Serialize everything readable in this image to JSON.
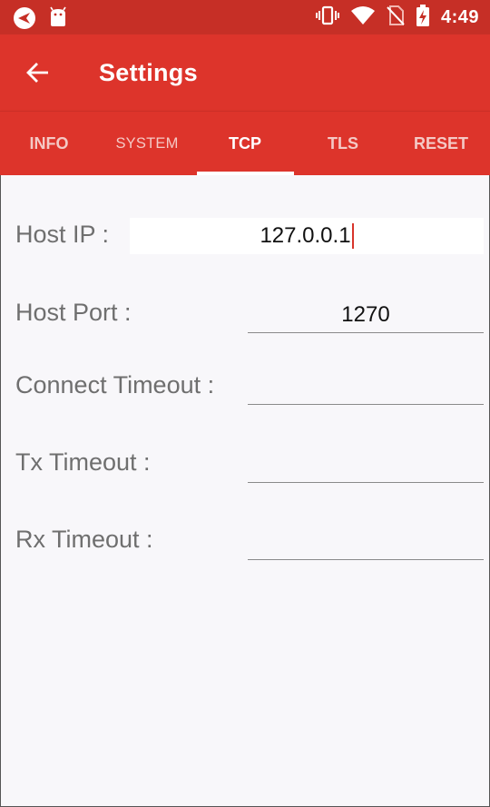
{
  "status_bar": {
    "time": "4:49",
    "icons": [
      "app-logo-icon",
      "android-icon",
      "vibrate-icon",
      "wifi-icon",
      "no-sim-icon",
      "battery-charging-icon"
    ]
  },
  "app_bar": {
    "title": "Settings",
    "back_icon": "arrow-back-icon"
  },
  "tabs": [
    {
      "label": "INFO",
      "active": false
    },
    {
      "label": "SYSTEM",
      "active": false
    },
    {
      "label": "TCP",
      "active": true
    },
    {
      "label": "TLS",
      "active": false
    },
    {
      "label": "RESET",
      "active": false
    }
  ],
  "form": {
    "host_ip": {
      "label": "Host IP :",
      "value": "127.0.0.1"
    },
    "host_port": {
      "label": "Host Port :",
      "value": "1270"
    },
    "connect_timeout": {
      "label": "Connect Timeout :",
      "value": ""
    },
    "tx_timeout": {
      "label": "Tx Timeout :",
      "value": ""
    },
    "rx_timeout": {
      "label": "Rx Timeout :",
      "value": ""
    }
  },
  "colors": {
    "status_bar": "#c62f26",
    "app_bar": "#dd342b",
    "background": "#f8f7fa",
    "label_text": "#6f6f6f"
  }
}
